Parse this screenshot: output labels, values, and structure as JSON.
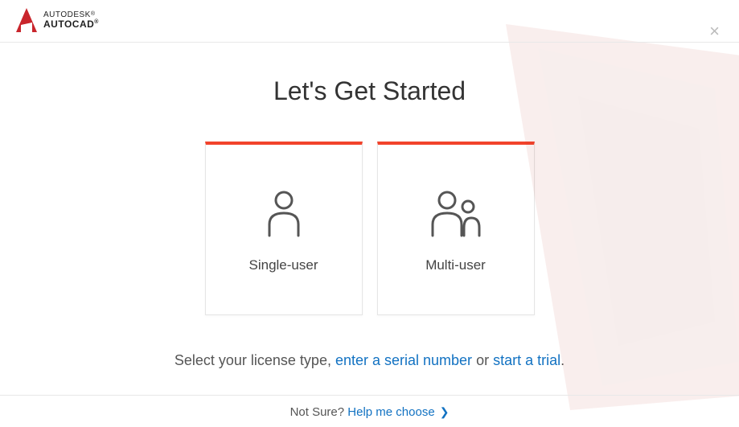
{
  "brand": {
    "line1": "AUTODESK",
    "line2": "AUTOCAD"
  },
  "title": "Let's Get Started",
  "cards": {
    "single": "Single-user",
    "multi": "Multi-user"
  },
  "subtext": {
    "prefix": "Select your license type, ",
    "serial_link": "enter a serial number",
    "mid": " or ",
    "trial_link": "start a trial",
    "suffix": "."
  },
  "footer": {
    "prefix": "Not Sure? ",
    "help_link": "Help me choose"
  }
}
